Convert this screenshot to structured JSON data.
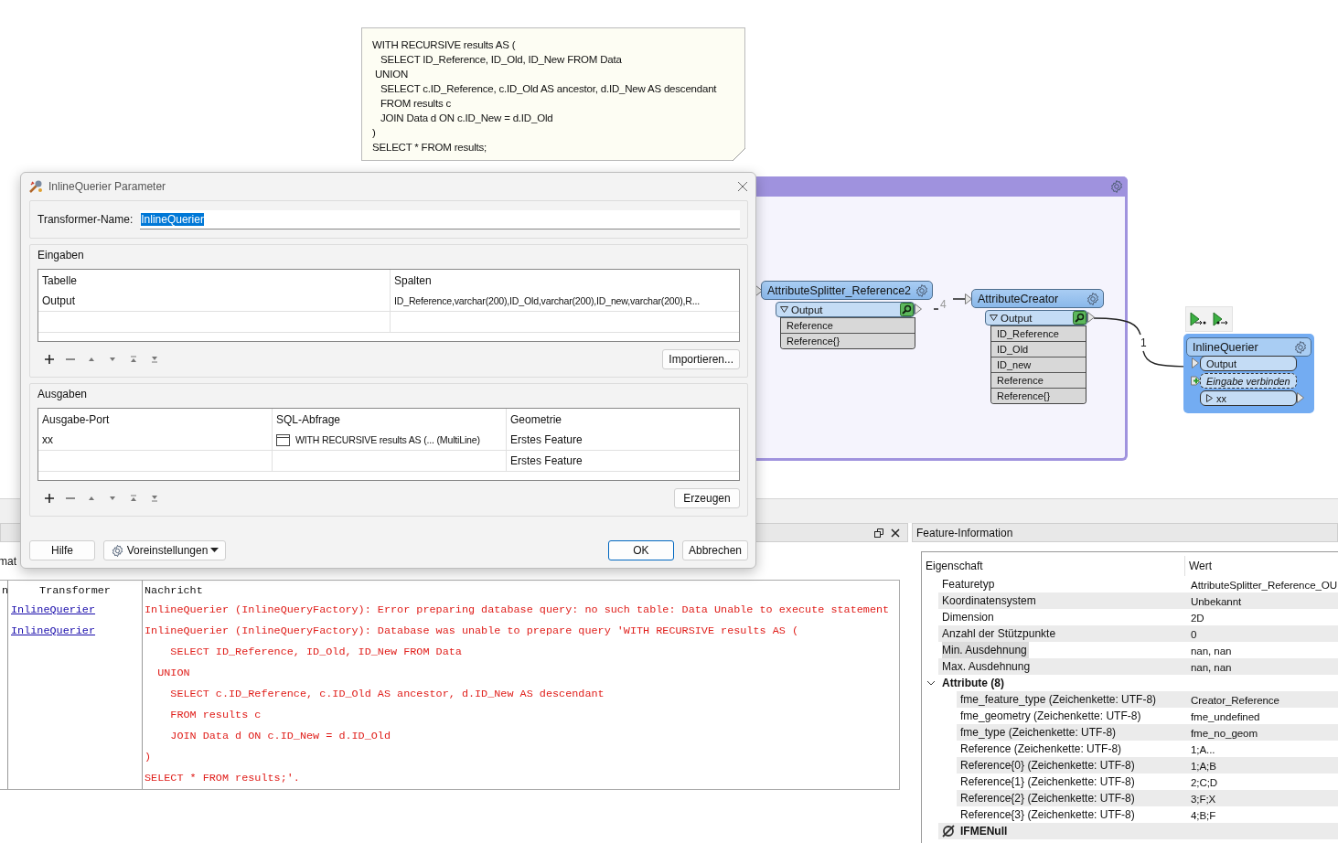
{
  "annotation": {
    "text": "WITH RECURSIVE results AS (\n   SELECT ID_Reference, ID_Old, ID_New FROM Data\n UNION\n   SELECT c.ID_Reference, c.ID_Old AS ancestor, d.ID_New AS descendant\n   FROM results c\n   JOIN Data d ON c.ID_New = d.ID_Old\n)\nSELECT * FROM results;"
  },
  "nodes": [
    {
      "name": "AttributeSplitter_Reference2",
      "port": "Output",
      "attributes": [
        "Reference",
        "Reference{}"
      ]
    },
    {
      "name": "AttributeCreator",
      "port": "Output",
      "attributes": [
        "ID_Reference",
        "ID_Old",
        "ID_new",
        "Reference",
        "Reference{}"
      ]
    }
  ],
  "connections": [
    {
      "count": "4"
    },
    {
      "count": "1"
    }
  ],
  "querier": {
    "name": "InlineQuerier",
    "ports": [
      {
        "kind": "input",
        "label": "Output"
      },
      {
        "kind": "add_input",
        "label": "Eingabe verbinden"
      },
      {
        "kind": "output",
        "label": "xx"
      }
    ]
  },
  "dialog": {
    "title": "InlineQuerier Parameter",
    "name_label": "Transformer-Name:",
    "name_value": "InlineQuerier",
    "name_selected": true,
    "inputs": {
      "title": "Eingaben",
      "columns": [
        "Tabelle",
        "Spalten"
      ],
      "rows": [
        [
          "Output",
          "ID_Reference,varchar(200),ID_Old,varchar(200),ID_new,varchar(200),R..."
        ]
      ],
      "button": "Importieren..."
    },
    "outputs": {
      "title": "Ausgaben",
      "columns": [
        "Ausgabe-Port",
        "SQL-Abfrage",
        "Geometrie"
      ],
      "rows": [
        {
          "port": "xx",
          "query": "WITH RECURSIVE results AS (... (MultiLine)",
          "geometry": "Erstes Feature"
        },
        {
          "geometry": "Erstes Feature"
        }
      ],
      "button": "Erzeugen"
    },
    "buttons": [
      {
        "kind": "plain",
        "label": "Hilfe"
      },
      {
        "kind": "menu",
        "label": "Voreinstellungen"
      },
      {
        "kind": "default",
        "label": "OK"
      },
      {
        "kind": "plain",
        "label": "Abbrechen"
      }
    ]
  },
  "log": {
    "tab_fragment": "mat",
    "columns": [
      "n",
      "Transformer",
      "Nachricht"
    ],
    "rows": [
      {
        "transformer": "InlineQuerier",
        "message": "InlineQuerier (InlineQueryFactory): Error preparing database query: no such table: Data Unable to execute statement"
      },
      {
        "transformer": "InlineQuerier",
        "message": "InlineQuerier (InlineQueryFactory): Database was unable to prepare query 'WITH RECURSIVE results AS (\n    SELECT ID_Reference, ID_Old, ID_New FROM Data\n  UNION\n    SELECT c.ID_Reference, c.ID_Old AS ancestor, d.ID_New AS descendant\n    FROM results c\n    JOIN Data d ON c.ID_New = d.ID_Old\n)\nSELECT * FROM results;'."
      }
    ]
  },
  "feature_info": {
    "title": "Feature-Information",
    "columns": [
      "Eigenschaft",
      "Wert"
    ],
    "properties": [
      {
        "label": "Featuretyp",
        "value": "AttributeSplitter_Reference_OU",
        "selected": false
      },
      {
        "label": "Koordinatensystem",
        "value": "Unbekannt",
        "selected": false
      },
      {
        "label": "Dimension",
        "value": "2D",
        "selected": false
      },
      {
        "label": "Anzahl der Stützpunkte",
        "value": "0",
        "selected": false
      },
      {
        "label": "Min. Ausdehnung",
        "value": "nan, nan",
        "selected": true
      },
      {
        "label": "Max. Ausdehnung",
        "value": "nan, nan",
        "selected": false
      }
    ],
    "attributes": {
      "label": "Attribute (8)",
      "expanded": true,
      "children": [
        {
          "label": "fme_feature_type (Zeichenkette: UTF-8)",
          "value": "Creator_Reference"
        },
        {
          "label": "fme_geometry (Zeichenkette: UTF-8)",
          "value": "fme_undefined"
        },
        {
          "label": "fme_type (Zeichenkette: UTF-8)",
          "value": "fme_no_geom"
        },
        {
          "label": "Reference (Zeichenkette: UTF-8)",
          "value": "1;A..."
        },
        {
          "label": "Reference{0} (Zeichenkette: UTF-8)",
          "value": "1;A;B"
        },
        {
          "label": "Reference{1} (Zeichenkette: UTF-8)",
          "value": "2;C;D"
        },
        {
          "label": "Reference{2} (Zeichenkette: UTF-8)",
          "value": "3;F;X"
        },
        {
          "label": "Reference{3} (Zeichenkette: UTF-8)",
          "value": "4;B;F"
        }
      ]
    },
    "null_row": {
      "label": "IFMENull"
    }
  }
}
